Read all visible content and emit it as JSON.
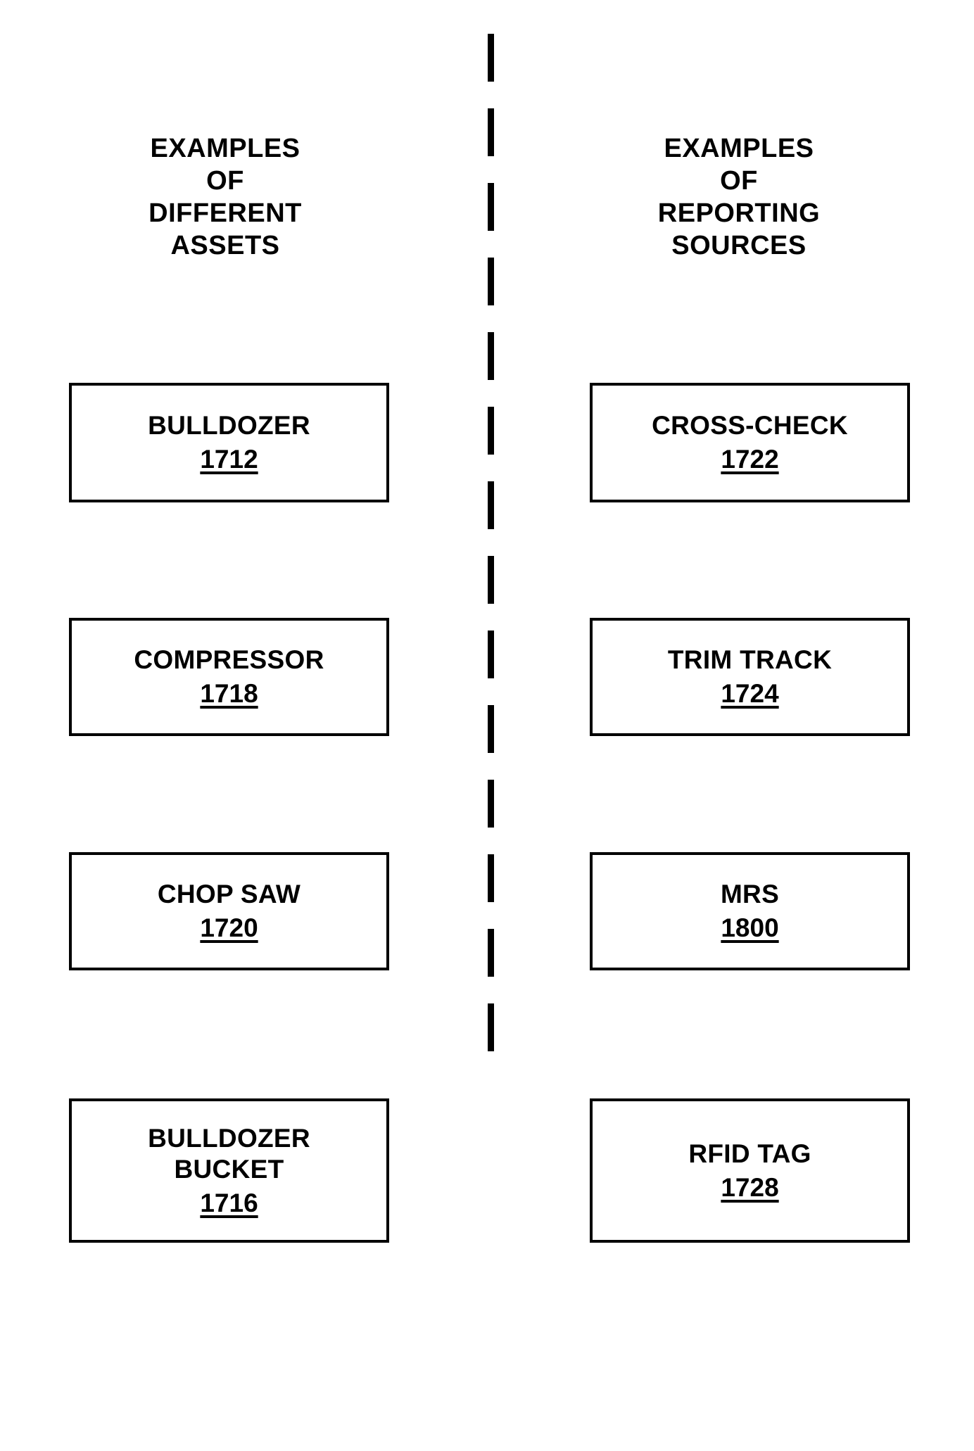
{
  "figure": {
    "type": "patent-diagram",
    "background_color": "#ffffff",
    "line_color": "#000000",
    "divider": {
      "style": "dashed-vertical"
    }
  },
  "columns": {
    "left": {
      "heading_lines": [
        "EXAMPLES",
        "OF",
        "DIFFERENT",
        "ASSETS"
      ],
      "boxes": [
        {
          "title_lines": [
            "BULLDOZER"
          ],
          "ref": "1712"
        },
        {
          "title_lines": [
            "COMPRESSOR"
          ],
          "ref": "1718"
        },
        {
          "title_lines": [
            "CHOP SAW"
          ],
          "ref": "1720"
        },
        {
          "title_lines": [
            "BULLDOZER",
            "BUCKET"
          ],
          "ref": "1716"
        }
      ]
    },
    "right": {
      "heading_lines": [
        "EXAMPLES",
        "OF",
        "REPORTING",
        "SOURCES"
      ],
      "boxes": [
        {
          "title_lines": [
            "CROSS-CHECK"
          ],
          "ref": "1722"
        },
        {
          "title_lines": [
            "TRIM TRACK"
          ],
          "ref": "1724"
        },
        {
          "title_lines": [
            "MRS"
          ],
          "ref": "1800"
        },
        {
          "title_lines": [
            "RFID TAG"
          ],
          "ref": "1728"
        }
      ]
    }
  }
}
